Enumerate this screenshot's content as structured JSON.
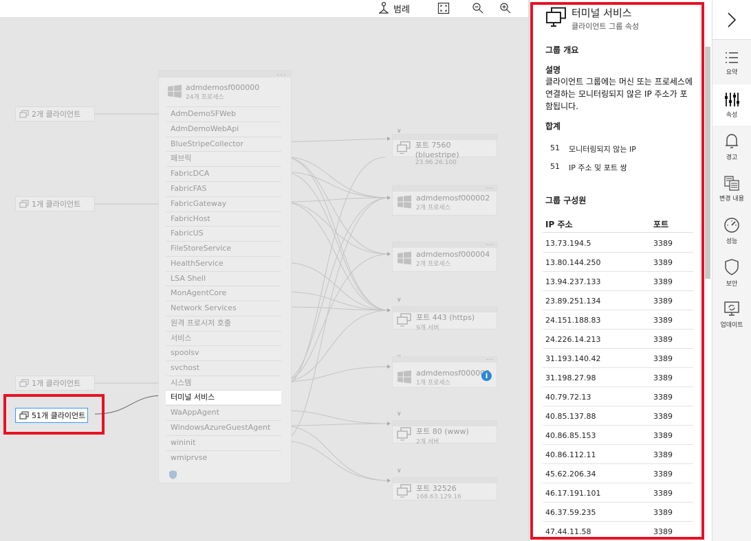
{
  "toolbar": {
    "legend_label": "범례"
  },
  "clients": [
    {
      "label": "2개 클라이언트"
    },
    {
      "label": "1개 클라이언트"
    },
    {
      "label": "1개 클라이언트"
    },
    {
      "label": "51개 클라이언트"
    }
  ],
  "machine": {
    "name": "admdemosf000000",
    "sub": "24개 프로세스",
    "processes": [
      "AdmDemoSFWeb",
      "AdmDemoWebApi",
      "BlueStripeCollector",
      "패브릭",
      "FabricDCA",
      "FabricFAS",
      "FabricGateway",
      "FabricHost",
      "FabricUS",
      "FileStoreService",
      "HealthService",
      "LSA Shell",
      "MonAgentCore",
      "Network Services",
      "원격 프로시저 호출",
      "서비스",
      "spoolsv",
      "svchost",
      "시스템",
      "터미널 서비스",
      "WaAppAgent",
      "WindowsAzureGuestAgent",
      "wininit",
      "wmiprvse"
    ]
  },
  "nodes": [
    {
      "title": "포트 7560 (bluestripe)",
      "sub": "23.96.26.100"
    },
    {
      "title": "admdemosf000002",
      "sub": "2개 프로세스"
    },
    {
      "title": "admdemosf000004",
      "sub": "2개 프로세스"
    },
    {
      "title": "포트 443 (https)",
      "sub": "9개 서버"
    },
    {
      "title": "admdemosf000003",
      "sub": "1개 프로세스"
    },
    {
      "title": "포트 80 (www)",
      "sub": "2개 서버"
    },
    {
      "title": "포트 32526",
      "sub": "168.63.129.16"
    }
  ],
  "panel": {
    "title": "터미널 서비스",
    "subtitle": "클라이언트 그룹 속성",
    "overview_heading": "그룹 개요",
    "desc_label": "설명",
    "desc_text": "클라이언트 그룹에는 머신 또는 프로세스에 연결하는 모니터링되지 않은 IP 주소가 포함됩니다.",
    "total_label": "합계",
    "totals": [
      {
        "count": "51",
        "label": "모니터링되지 않는 IP"
      },
      {
        "count": "51",
        "label": "IP 주소 및 포트 쌍"
      }
    ],
    "members_heading": "그룹 구성원",
    "col_ip": "IP 주소",
    "col_port": "포트",
    "members": [
      {
        "ip": "13.73.194.5",
        "port": "3389"
      },
      {
        "ip": "13.80.144.250",
        "port": "3389"
      },
      {
        "ip": "13.94.237.133",
        "port": "3389"
      },
      {
        "ip": "23.89.251.134",
        "port": "3389"
      },
      {
        "ip": "24.151.188.83",
        "port": "3389"
      },
      {
        "ip": "24.226.14.213",
        "port": "3389"
      },
      {
        "ip": "31.193.140.42",
        "port": "3389"
      },
      {
        "ip": "31.198.27.98",
        "port": "3389"
      },
      {
        "ip": "40.79.72.13",
        "port": "3389"
      },
      {
        "ip": "40.85.137.88",
        "port": "3389"
      },
      {
        "ip": "40.86.85.153",
        "port": "3389"
      },
      {
        "ip": "40.86.112.11",
        "port": "3389"
      },
      {
        "ip": "45.62.206.34",
        "port": "3389"
      },
      {
        "ip": "46.17.191.101",
        "port": "3389"
      },
      {
        "ip": "46.37.59.235",
        "port": "3389"
      },
      {
        "ip": "47.44.11.58",
        "port": "3389"
      }
    ]
  },
  "rail": [
    {
      "label": "요약",
      "icon": "list-icon"
    },
    {
      "label": "속성",
      "icon": "sliders-icon"
    },
    {
      "label": "경고",
      "icon": "bell-icon"
    },
    {
      "label": "변경 내용",
      "icon": "changes-icon"
    },
    {
      "label": "성능",
      "icon": "gauge-icon"
    },
    {
      "label": "보안",
      "icon": "shield-icon"
    },
    {
      "label": "업데이트",
      "icon": "update-icon"
    }
  ],
  "colors": {
    "highlight": "#e81123",
    "selection": "#3399ff",
    "info": "#2b88d8"
  }
}
